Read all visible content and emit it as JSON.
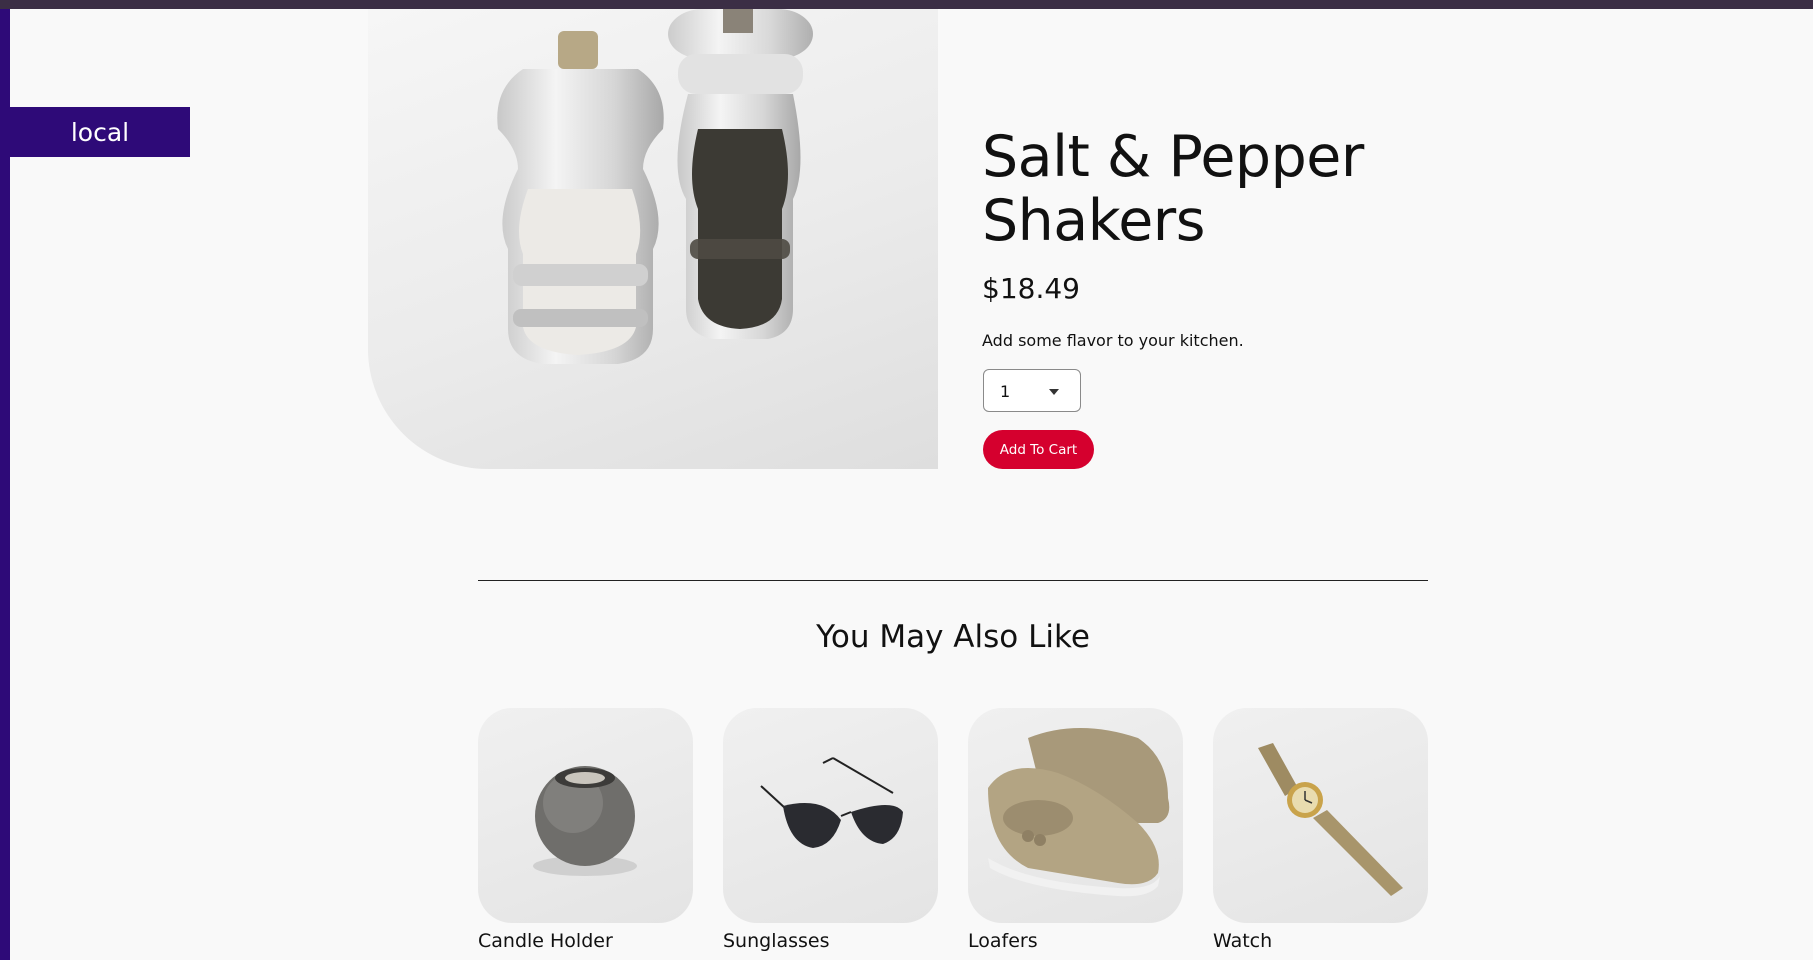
{
  "environment": {
    "label": "local"
  },
  "product": {
    "title": "Salt & Pepper Shakers",
    "price": "$18.49",
    "description": "Add some flavor to your kitchen.",
    "quantity": "1",
    "add_to_cart_label": "Add To Cart"
  },
  "recommendations": {
    "heading": "You May Also Like",
    "items": [
      {
        "label": "Candle Holder"
      },
      {
        "label": "Sunglasses"
      },
      {
        "label": "Loafers"
      },
      {
        "label": "Watch"
      }
    ]
  },
  "colors": {
    "accent": "#2e0a78",
    "top_bar": "#3b2e45",
    "button": "#d5002e",
    "background": "#f9f9f9"
  }
}
